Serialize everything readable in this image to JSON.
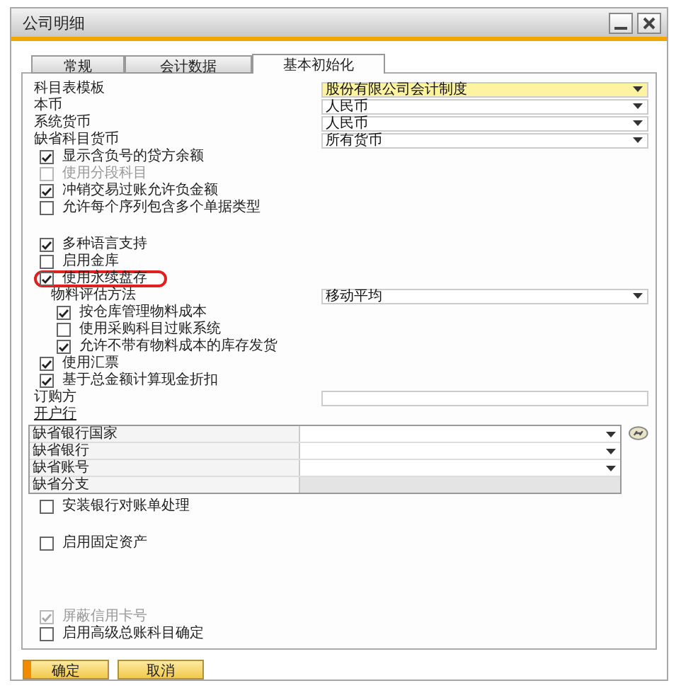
{
  "window": {
    "title": "公司明细"
  },
  "tabs": [
    {
      "label": "常规",
      "selected": false
    },
    {
      "label": "会计数据",
      "selected": false
    },
    {
      "label": "基本初始化",
      "selected": true
    }
  ],
  "sections": [
    {
      "rows": [
        {
          "kind": "dropdown",
          "label": "科目表模板",
          "value": "股份有限公司会计制度",
          "highlighted": true
        },
        {
          "kind": "dropdown",
          "label": "本币",
          "value": "人民币",
          "highlighted": false
        },
        {
          "kind": "dropdown",
          "label": "系统货币",
          "value": "人民币",
          "highlighted": false
        },
        {
          "kind": "dropdown",
          "label": "缺省科目货币",
          "value": "所有货币",
          "highlighted": false
        },
        {
          "kind": "checkbox",
          "label": "显示含负号的贷方余额",
          "checked": true,
          "disabled": false
        },
        {
          "kind": "checkbox",
          "label": "使用分段科目",
          "checked": false,
          "disabled": true
        },
        {
          "kind": "checkbox",
          "label": "冲销交易过账允许负金额",
          "checked": true,
          "disabled": false
        },
        {
          "kind": "checkbox",
          "label": "允许每个序列包含多个单据类型",
          "checked": false,
          "disabled": false
        }
      ]
    },
    {
      "rows": [
        {
          "kind": "checkbox",
          "label": "多种语言支持",
          "checked": true,
          "disabled": false
        },
        {
          "kind": "checkbox",
          "label": "启用金库",
          "checked": false,
          "disabled": false
        },
        {
          "kind": "checkbox",
          "label": "使用永续盘存",
          "checked": true,
          "disabled": false,
          "circled": true,
          "children": [
            {
              "kind": "dropdown",
              "label": "物料评估方法",
              "value": "移动平均",
              "highlighted": false
            },
            {
              "kind": "checkbox",
              "label": "按仓库管理物料成本",
              "checked": true,
              "disabled": false
            },
            {
              "kind": "checkbox",
              "label": "使用采购科目过账系统",
              "checked": false,
              "disabled": false
            },
            {
              "kind": "checkbox",
              "label": "允许不带有物料成本的库存发货",
              "checked": true,
              "disabled": false
            }
          ]
        },
        {
          "kind": "checkbox",
          "label": "使用汇票",
          "checked": true,
          "disabled": false
        },
        {
          "kind": "checkbox",
          "label": "基于总金额计算现金折扣",
          "checked": true,
          "disabled": false
        },
        {
          "kind": "text",
          "label": "订购方"
        },
        {
          "kind": "heading",
          "label": "开户行"
        },
        {
          "kind": "table",
          "rows": [
            {
              "kind": "dropdown",
              "label": "缺省银行国家"
            },
            {
              "kind": "dropdown",
              "label": "缺省银行"
            },
            {
              "kind": "dropdown",
              "label": "缺省账号"
            },
            {
              "kind": "readonly",
              "label": "缺省分支"
            }
          ]
        },
        {
          "kind": "checkbox",
          "label": "安装银行对账单处理",
          "checked": false,
          "disabled": false
        }
      ]
    },
    {
      "rows": [
        {
          "kind": "checkbox",
          "label": "启用固定资产",
          "checked": false,
          "disabled": false
        }
      ]
    },
    {
      "rows": [
        {
          "kind": "checkbox",
          "label": "屏蔽信用卡号",
          "checked": true,
          "disabled": true
        },
        {
          "kind": "checkbox",
          "label": "启用高级总账科目确定",
          "checked": false,
          "disabled": false
        }
      ]
    }
  ],
  "buttons": [
    {
      "label": "确定",
      "default": true
    },
    {
      "label": "取消",
      "default": false
    }
  ]
}
